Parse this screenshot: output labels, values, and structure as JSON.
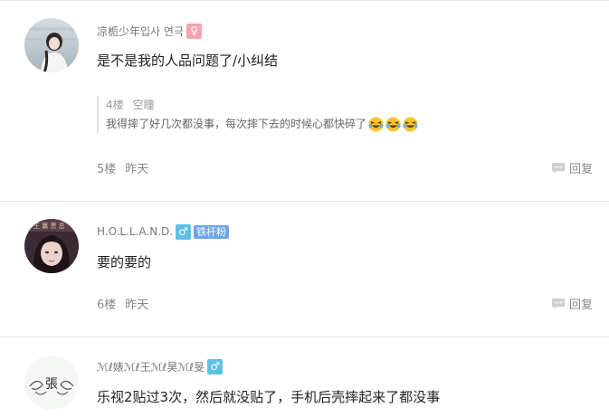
{
  "comments": [
    {
      "username": "凉栀少年입사 연극",
      "gender": "♀",
      "content": "是不是我的人品问题了/小纠结",
      "quote": {
        "floor": "4楼",
        "user": "空瞳",
        "text": "我得摔了好几次都没事，每次摔下去的时候心都快碎了"
      },
      "floor": "5楼",
      "time": "昨天",
      "reply_label": "回复"
    },
    {
      "username": "H.O.L.L.A.N.D.",
      "gender": "♂",
      "badge": "铁杆粉",
      "content": "要的要的",
      "floor": "6楼",
      "time": "昨天",
      "reply_label": "回复"
    },
    {
      "username": "ℳℓ婊ℳℓ王ℳℓ昊ℳℓ旻",
      "gender": "♂",
      "avatar_text": "張",
      "content": "乐视2贴过3次，然后就没贴了，手机后壳摔起来了都没事"
    }
  ],
  "colors": {
    "gender_female": "#f3a6b2",
    "gender_male": "#5cc1e6",
    "fan_badge": "#6aa6e6",
    "divider": "#e8e8e8"
  },
  "icons": {
    "reply": "speech-bubble-icon",
    "emoji": "laughing-tears-emoji-icon"
  }
}
